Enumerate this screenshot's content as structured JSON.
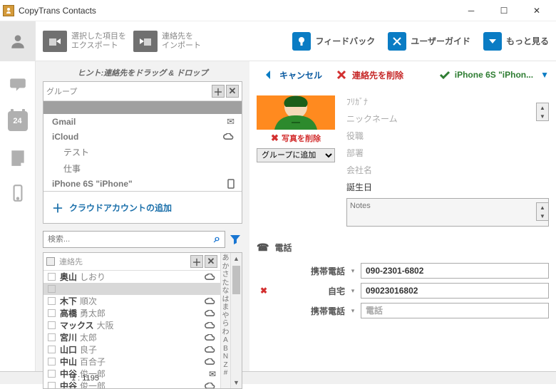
{
  "app": {
    "title": "CopyTrans Contacts"
  },
  "toolbar": {
    "export": {
      "line1": "選択した項目を",
      "line2": "エクスポート"
    },
    "import": {
      "line1": "連絡先を",
      "line2": "インポート"
    },
    "feedback": "フィードバック",
    "userguide": "ユーザーガイド",
    "more": "もっと見る"
  },
  "sidebar": {
    "calendar_day": "24"
  },
  "mid": {
    "hint": "ヒント:連絡先をドラッグ & ドロップ",
    "group_label": "グループ",
    "groups": [
      {
        "label": "Gmail",
        "type": "mail",
        "bold": true
      },
      {
        "label": "iCloud",
        "type": "cloud",
        "bold": true
      },
      {
        "label": "テスト",
        "type": "",
        "bold": false
      },
      {
        "label": "仕事",
        "type": "",
        "bold": false
      },
      {
        "label": "iPhone 6S \"iPhone\"",
        "type": "phone",
        "bold": true
      }
    ],
    "add_cloud": "クラウドアカウントの追加",
    "search_placeholder": "検索...",
    "contacts_label": "連絡先",
    "alpha": "あかさたなはまやらわABNZ#",
    "contacts": [
      {
        "surname": "奥山",
        "given": "しおり",
        "cloud": true
      },
      {
        "surname": "",
        "given": "",
        "selected": true
      },
      {
        "surname": "木下",
        "given": "順次",
        "cloud": true
      },
      {
        "surname": "高橋",
        "given": "勇太郎",
        "cloud": true
      },
      {
        "surname": "マックス",
        "given": "大阪",
        "cloud": true
      },
      {
        "surname": "宮川",
        "given": "太郎",
        "cloud": true
      },
      {
        "surname": "山口",
        "given": "良子",
        "cloud": true
      },
      {
        "surname": "中山",
        "given": "百合子",
        "cloud": true
      },
      {
        "surname": "中谷",
        "given": "俊一郎",
        "mail": true
      },
      {
        "surname": "中谷",
        "given": "俊一郎",
        "cloud": true
      }
    ]
  },
  "detail": {
    "cancel": "キャンセル",
    "delete_contact": "連絡先を削除",
    "device": "iPhone 6S \"iPhon...",
    "delete_photo": "写真を削除",
    "group_add": "グループに追加",
    "fields": {
      "reading": "ﾌﾘｶﾞﾅ",
      "nickname": "ニックネーム",
      "title": "役職",
      "department": "部署",
      "company": "会社名",
      "birthday": "誕生日"
    },
    "notes_placeholder": "Notes",
    "phone_section": "電話",
    "phones": [
      {
        "type": "携帯電話",
        "value": "090-2301-6802",
        "del": false
      },
      {
        "type": "自宅",
        "value": "09023016802",
        "del": true
      },
      {
        "type": "携帯電話",
        "value": "",
        "placeholder": "電話",
        "del": false
      }
    ]
  },
  "status": {
    "text": "1 : 1195"
  }
}
